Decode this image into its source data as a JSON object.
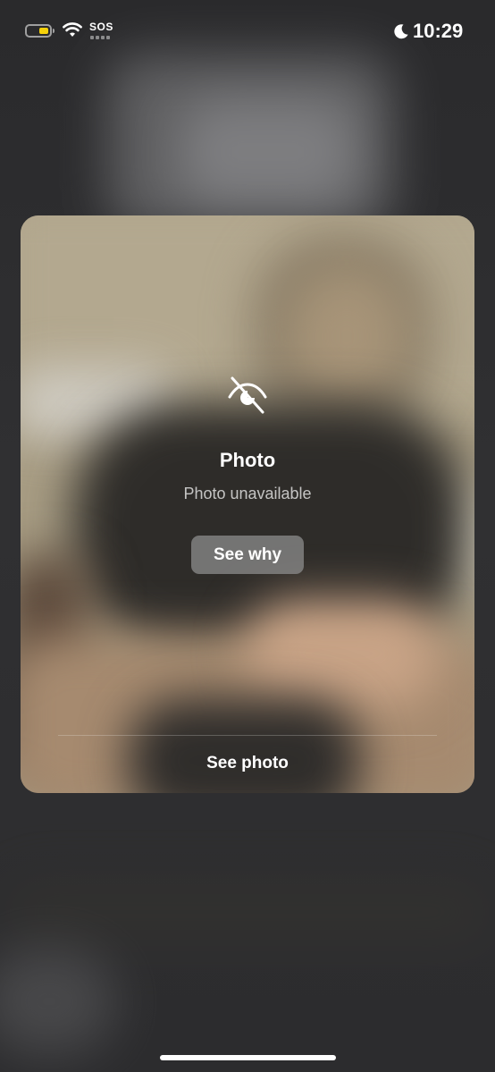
{
  "status_bar": {
    "time": "10:29",
    "carrier_text": "SOS",
    "battery_level": 0.45,
    "battery_color": "#f5d10a",
    "icons": [
      "battery-icon",
      "wifi-icon",
      "moon-icon"
    ]
  },
  "card": {
    "icon": "eye-slash-icon",
    "title": "Photo",
    "subtitle": "Photo unavailable",
    "see_why_label": "See why",
    "see_photo_label": "See photo"
  }
}
